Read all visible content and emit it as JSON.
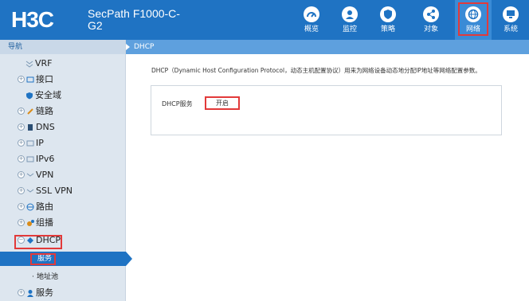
{
  "header": {
    "logo": "H3C",
    "product": "SecPath F1000-C-G2",
    "nav": [
      {
        "label": "概览",
        "icon": "dashboard-icon",
        "active": false
      },
      {
        "label": "监控",
        "icon": "monitor-icon",
        "active": false
      },
      {
        "label": "策略",
        "icon": "shield-icon",
        "active": false
      },
      {
        "label": "对象",
        "icon": "share-icon",
        "active": false
      },
      {
        "label": "网络",
        "icon": "globe-icon",
        "active": true
      },
      {
        "label": "系统",
        "icon": "system-icon",
        "active": false
      }
    ]
  },
  "sidebar": {
    "title": "导航",
    "items": [
      {
        "label": "VRF"
      },
      {
        "label": "接口"
      },
      {
        "label": "安全域"
      },
      {
        "label": "链路"
      },
      {
        "label": "DNS"
      },
      {
        "label": "IP"
      },
      {
        "label": "IPv6"
      },
      {
        "label": "VPN"
      },
      {
        "label": "SSL VPN"
      },
      {
        "label": "路由"
      },
      {
        "label": "组播"
      },
      {
        "label": "DHCP"
      },
      {
        "label": "服务"
      },
      {
        "label": "地址池"
      },
      {
        "label": "服务"
      }
    ]
  },
  "breadcrumb": "DHCP",
  "content": {
    "description": "DHCP（Dynamic Host Configuration Protocol，动态主机配置协议）用来为网络设备动态地分配IP地址等网络配置参数。",
    "service_label": "DHCP服务",
    "service_value": "开启"
  },
  "colors": {
    "header_bg": "#1f73c3",
    "sidebar_bg": "#dde6ef",
    "highlight": "#e23a3a"
  }
}
